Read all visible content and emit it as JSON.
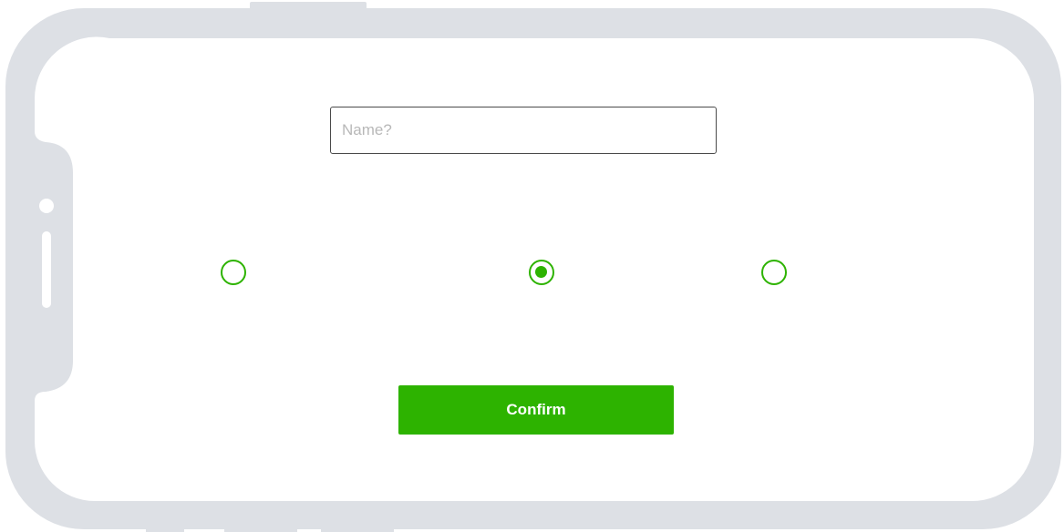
{
  "form": {
    "name_placeholder": "Name?",
    "name_value": "",
    "options": [
      {
        "selected": false
      },
      {
        "selected": true
      },
      {
        "selected": false
      }
    ],
    "confirm_label": "Confirm"
  },
  "colors": {
    "accent": "#2db300",
    "frame": "#dde0e5",
    "input_border": "#4a4a4a"
  }
}
